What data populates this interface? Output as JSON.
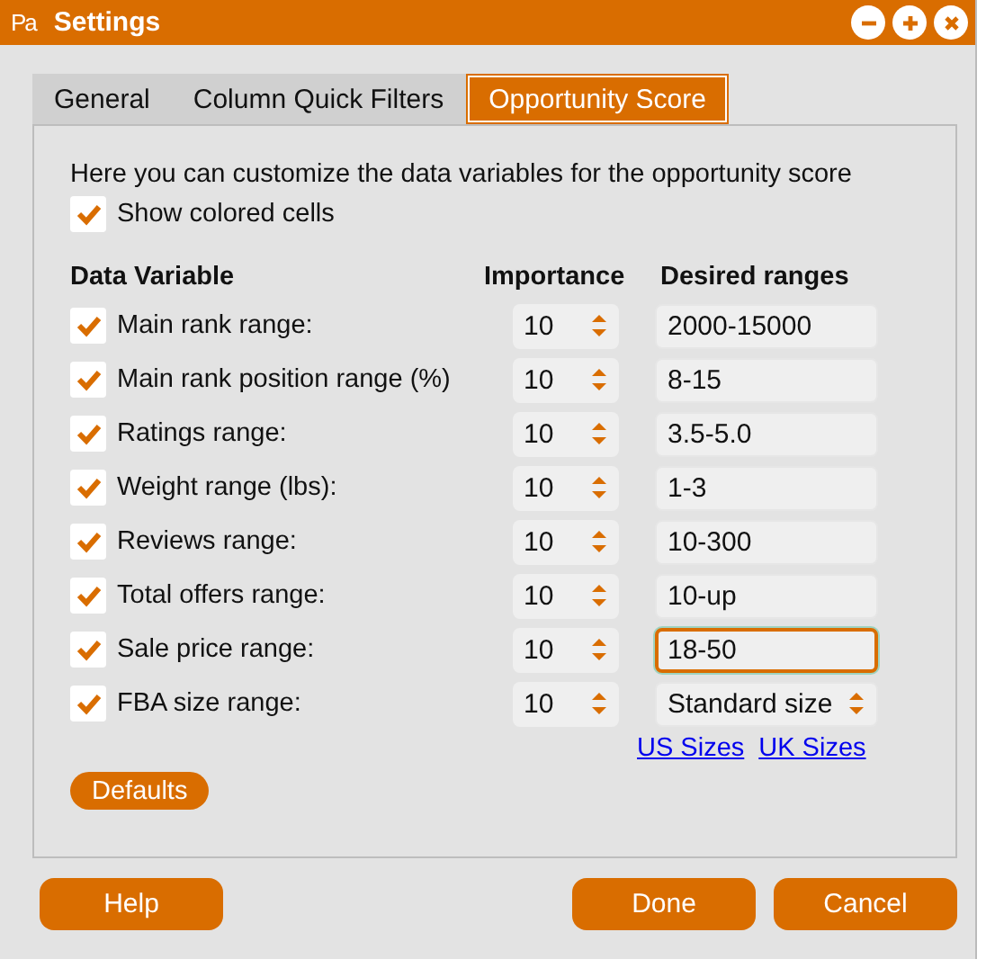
{
  "window": {
    "app_icon": "Pa",
    "title": "Settings",
    "controls": [
      {
        "kind": "minimize"
      },
      {
        "kind": "maximize"
      },
      {
        "kind": "close"
      }
    ]
  },
  "tabs": [
    {
      "label": "General",
      "selected": false
    },
    {
      "label": "Column Quick Filters",
      "selected": false
    },
    {
      "label": "Opportunity Score",
      "selected": true
    }
  ],
  "intro": "Here you can customize the data variables for the opportunity score",
  "show_colored_cells": {
    "label": "Show colored cells",
    "checked": true
  },
  "columns": [
    "Data Variable",
    "Importance",
    "Desired ranges"
  ],
  "variables": [
    {
      "label": "Main rank range:",
      "checked": true,
      "importance": "10",
      "range": {
        "kind": "text",
        "value": "2000-15000",
        "focused": false
      }
    },
    {
      "label": "Main rank position range (%)",
      "checked": true,
      "importance": "10",
      "range": {
        "kind": "text",
        "value": "8-15",
        "focused": false
      }
    },
    {
      "label": "Ratings range:",
      "checked": true,
      "importance": "10",
      "range": {
        "kind": "text",
        "value": "3.5-5.0",
        "focused": false
      }
    },
    {
      "label": "Weight range (lbs):",
      "checked": true,
      "importance": "10",
      "range": {
        "kind": "text",
        "value": "1-3",
        "focused": false
      }
    },
    {
      "label": "Reviews range:",
      "checked": true,
      "importance": "10",
      "range": {
        "kind": "text",
        "value": "10-300",
        "focused": false
      }
    },
    {
      "label": "Total offers range:",
      "checked": true,
      "importance": "10",
      "range": {
        "kind": "text",
        "value": "10-up",
        "focused": false
      }
    },
    {
      "label": "Sale price range:",
      "checked": true,
      "importance": "10",
      "range": {
        "kind": "text",
        "value": "18-50",
        "focused": true
      }
    },
    {
      "label": "FBA size range:",
      "checked": true,
      "importance": "10",
      "range": {
        "kind": "select",
        "value": "Standard size",
        "focused": false
      }
    }
  ],
  "size_links": [
    "US Sizes",
    "UK Sizes"
  ],
  "defaults_button": "Defaults",
  "footer_left_buttons": [
    "Help"
  ],
  "footer_right_buttons": [
    "Done",
    "Cancel"
  ]
}
